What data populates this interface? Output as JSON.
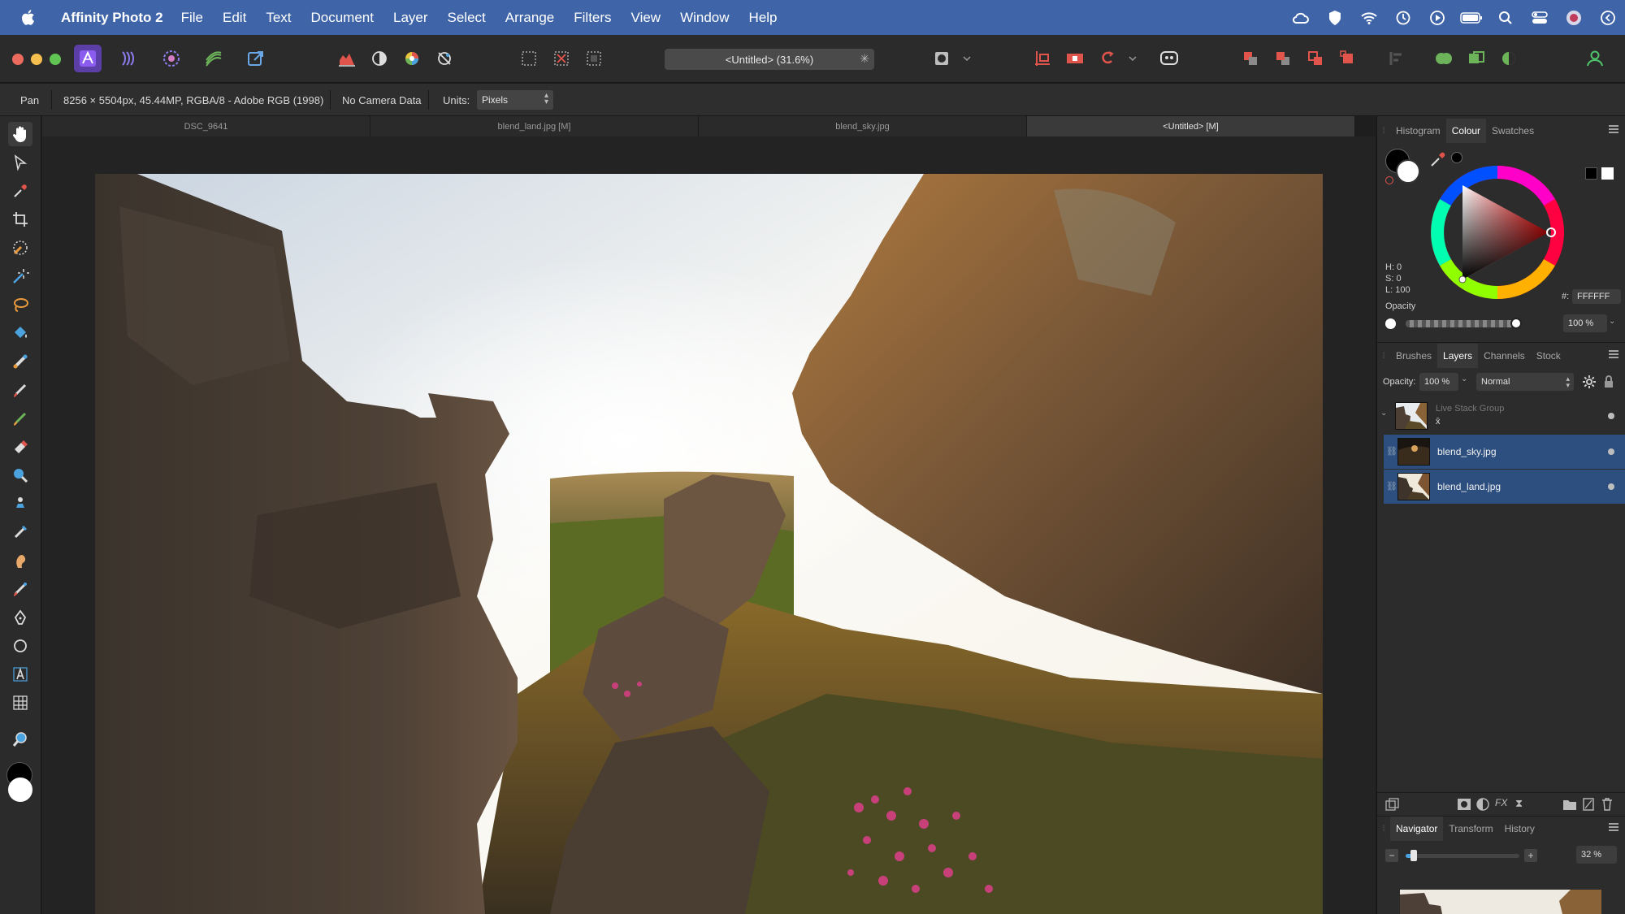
{
  "menubar": {
    "app_name": "Affinity Photo 2",
    "items": [
      "File",
      "Edit",
      "Text",
      "Document",
      "Layer",
      "Select",
      "Arrange",
      "Filters",
      "View",
      "Window",
      "Help"
    ]
  },
  "toolbar": {
    "document_title": "<Untitled> (31.6%)"
  },
  "context": {
    "tool_name": "Pan",
    "image_info": "8256 × 5504px, 45.44MP, RGBA/8 - Adobe RGB (1998)",
    "camera_data": "No Camera Data",
    "units_label": "Units:",
    "units_value": "Pixels"
  },
  "doc_tabs": [
    "DSC_9641",
    "blend_land.jpg [M]",
    "blend_sky.jpg",
    "<Untitled> [M]"
  ],
  "colour_panel": {
    "tabs": [
      "Histogram",
      "Colour",
      "Swatches"
    ],
    "h": "H: 0",
    "s": "S: 0",
    "l": "L: 100",
    "hex_label": "#:",
    "hex_value": "FFFFFF",
    "opacity_label": "Opacity",
    "opacity_value": "100 %"
  },
  "layers_panel": {
    "tabs": [
      "Brushes",
      "Layers",
      "Channels",
      "Stock"
    ],
    "opacity_label": "Opacity:",
    "opacity_value": "100 %",
    "blend_mode": "Normal",
    "group_name": "Live Stack Group",
    "group_symbol": "x̄",
    "layers": [
      "blend_sky.jpg",
      "blend_land.jpg"
    ]
  },
  "navigator_panel": {
    "tabs": [
      "Navigator",
      "Transform",
      "History"
    ],
    "zoom_value": "32 %",
    "zoom_fraction": 0.07
  },
  "colors": {
    "menubar": "#3f65a8",
    "accent_purple": "#5b3ea6",
    "layer_selected": "#2d4f7f"
  }
}
